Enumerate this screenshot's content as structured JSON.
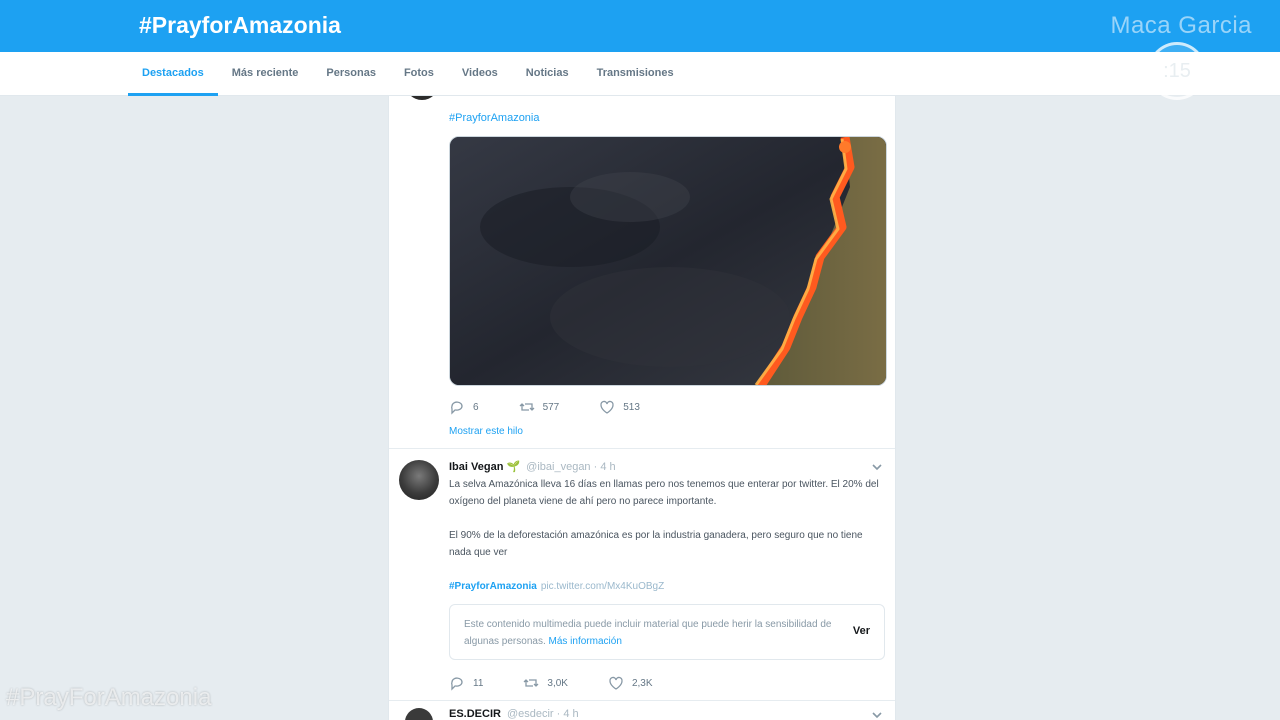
{
  "header": {
    "title": "#PrayforAmazonia",
    "author": "Maca Garcia"
  },
  "nav": {
    "tabs": [
      {
        "label": "Destacados"
      },
      {
        "label": "Más reciente"
      },
      {
        "label": "Personas"
      },
      {
        "label": "Fotos"
      },
      {
        "label": "Videos"
      },
      {
        "label": "Noticias"
      },
      {
        "label": "Transmisiones"
      }
    ],
    "active_tab": "Destacados"
  },
  "overlay": {
    "timer": ":15",
    "watermark": "#PrayForAmazonia"
  },
  "tweet1": {
    "hashtag": "#PrayforAmazonia",
    "media_icon": "wildfire-photo",
    "replies": "6",
    "retweets": "577",
    "likes": "513",
    "show_thread": "Mostrar este hilo"
  },
  "tweet2": {
    "name": "Ibai Vegan 🌱",
    "meta": "@ibai_vegan · 4 h",
    "text1": "La selva Amazónica lleva 16 días en llamas pero nos tenemos que enterar por twitter. El 20% del oxígeno del planeta viene de ahí pero no parece importante.",
    "text2": "El 90% de la deforestación amazónica es por la industria ganadera, pero seguro que no tiene nada que ver",
    "hashtag": "#PrayforAmazonia",
    "link": "pic.twitter.com/Mx4KuOBgZ",
    "sensitive_text": "Este contenido multimedia puede incluir material que puede herir la sensibilidad de algunas personas.",
    "sensitive_more": "Más información",
    "view_label": "Ver",
    "replies": "11",
    "retweets": "3,0K",
    "likes": "2,3K"
  },
  "tweet3": {
    "name": "ES.DECIR",
    "meta": "@esdecir · 4 h"
  },
  "colors": {
    "brand": "#1da1f2",
    "background": "#e6ecf0"
  }
}
